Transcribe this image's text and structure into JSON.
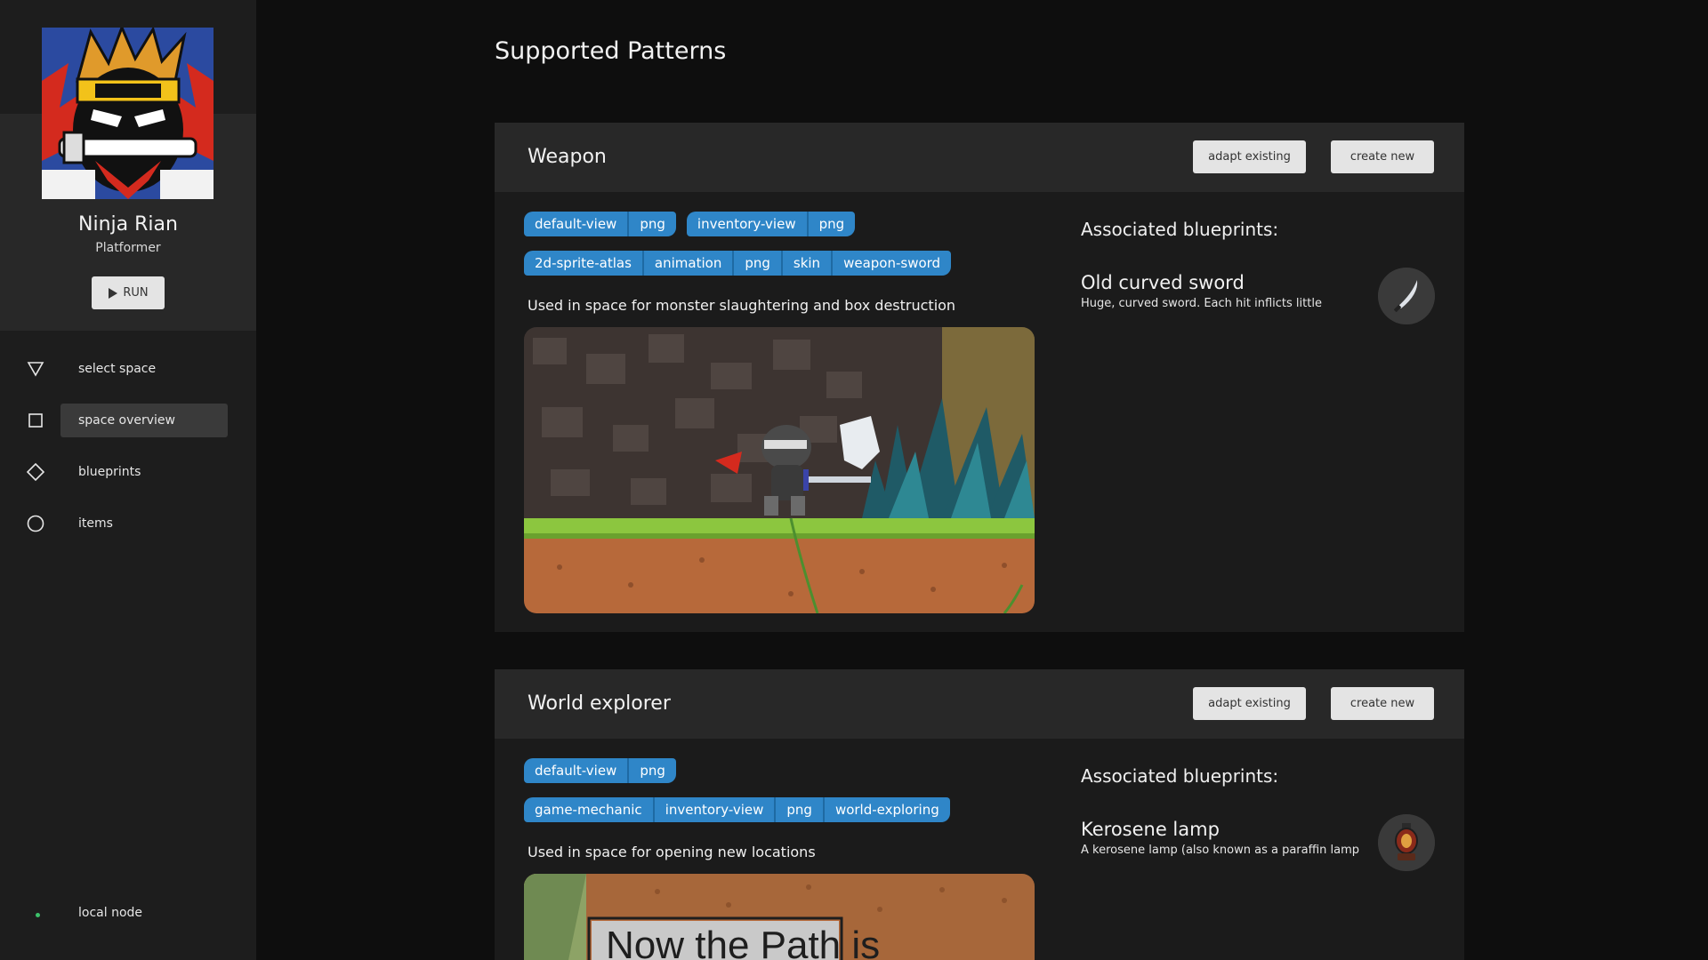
{
  "sidebar": {
    "space_name": "Ninja Rian",
    "space_genre": "Platformer",
    "run_label": "RUN",
    "nav": [
      {
        "label": "select space",
        "icon": "triangle-down-icon"
      },
      {
        "label": "space overview",
        "icon": "square-icon",
        "active": true
      },
      {
        "label": "blueprints",
        "icon": "diamond-icon"
      },
      {
        "label": "items",
        "icon": "circle-icon"
      }
    ],
    "status": {
      "label": "local node",
      "color": "#3cc26a"
    }
  },
  "main": {
    "page_title": "Supported Patterns",
    "buttons": {
      "adapt": "adapt existing",
      "create": "create new"
    },
    "assoc_title": "Associated blueprints:",
    "cards": [
      {
        "title": "Weapon",
        "tags_row1": [
          [
            "default-view",
            "png"
          ],
          [
            "inventory-view",
            "png"
          ]
        ],
        "tags_row2": [
          [
            "2d-sprite-atlas",
            "animation",
            "png",
            "skin",
            "weapon-sword"
          ]
        ],
        "description": "Used in space for monster slaughtering and box destruction",
        "blueprint": {
          "name": "Old curved sword",
          "desc": "Huge, curved sword. Each hit inflicts little",
          "icon": "sword-icon"
        }
      },
      {
        "title": "World explorer",
        "tags_row1": [
          [
            "default-view",
            "png"
          ]
        ],
        "tags_row2": [
          [
            "game-mechanic",
            "inventory-view",
            "png",
            "world-exploring"
          ]
        ],
        "description": "Used in space for opening new locations",
        "preview_text": "Now the Path is",
        "blueprint": {
          "name": "Kerosene lamp",
          "desc": "A kerosene lamp (also known as a paraffin lamp",
          "icon": "lamp-icon"
        }
      }
    ]
  },
  "colors": {
    "accent_tag": "#2f86c8",
    "sidebar": "#1d1d1d",
    "card": "#1b1b1b",
    "card_header": "#282828"
  }
}
